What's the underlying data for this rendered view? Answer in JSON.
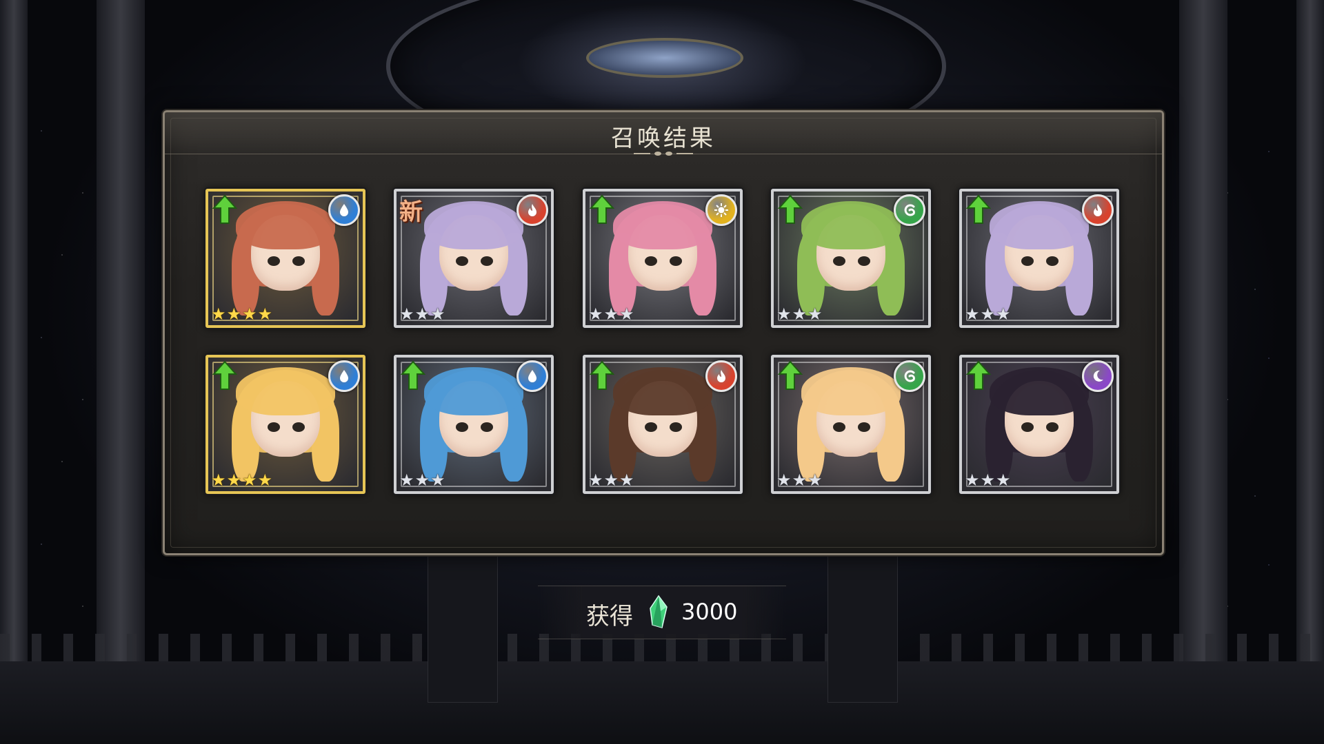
{
  "title": "召唤结果",
  "reward": {
    "label": "获得",
    "icon": "green-crystal-icon",
    "amount": "3000"
  },
  "colors": {
    "water": "#2f7fd6",
    "fire": "#d8432e",
    "light": "#e2b21f",
    "wind": "#36a54a",
    "dark": "#8a48c7",
    "gold_frame": "#e6c555",
    "silver_frame": "#cfd0d3"
  },
  "cards": [
    {
      "element": "water",
      "rarity": 4,
      "badge": "up-arrow",
      "frame": "gold"
    },
    {
      "element": "fire",
      "rarity": 3,
      "badge": "new",
      "badge_text": "新",
      "frame": "silver"
    },
    {
      "element": "light",
      "rarity": 3,
      "badge": "up-arrow",
      "frame": "silver"
    },
    {
      "element": "wind",
      "rarity": 3,
      "badge": "up-arrow",
      "frame": "silver"
    },
    {
      "element": "fire",
      "rarity": 3,
      "badge": "up-arrow",
      "frame": "silver"
    },
    {
      "element": "water",
      "rarity": 4,
      "badge": "up-arrow",
      "frame": "gold"
    },
    {
      "element": "water",
      "rarity": 3,
      "badge": "up-arrow",
      "frame": "silver"
    },
    {
      "element": "fire",
      "rarity": 3,
      "badge": "up-arrow",
      "frame": "silver"
    },
    {
      "element": "wind",
      "rarity": 3,
      "badge": "up-arrow",
      "frame": "silver"
    },
    {
      "element": "dark",
      "rarity": 3,
      "badge": "up-arrow",
      "frame": "silver"
    }
  ]
}
